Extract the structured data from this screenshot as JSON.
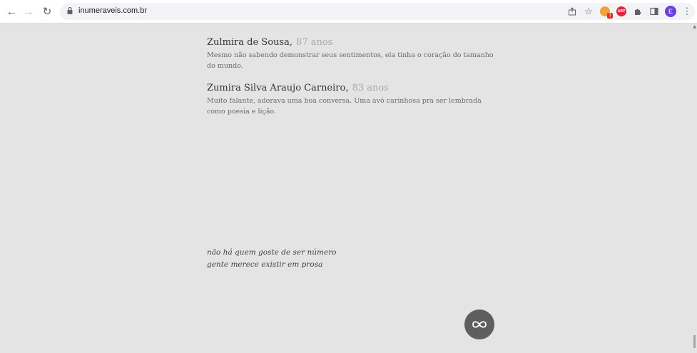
{
  "browser": {
    "url": "inumeraveis.com.br",
    "ext_badge": "1",
    "ext_red_label": "ABP",
    "avatar_letter": "E"
  },
  "entries": [
    {
      "name": "Zulmira de Sousa,",
      "age": "87 anos",
      "desc_line1": "Mesmo não sabendo demonstrar seus sentimentos, ela tinha o coração do tamanho",
      "desc_line2": "do mundo."
    },
    {
      "name": "Zumira Silva Araujo Carneiro,",
      "age": "83 anos",
      "desc_line1": "Muito falante, adorava uma boa conversa. Uma avó carinhosa pra ser lembrada",
      "desc_line2": "como poesia e lição."
    }
  ],
  "poem": {
    "line1": "não há quem goste de ser número",
    "line2": "gente merece existir em prosa"
  },
  "colors": {
    "page_bg": "#e4e4e4",
    "fab_bg": "#5e5e5e"
  }
}
